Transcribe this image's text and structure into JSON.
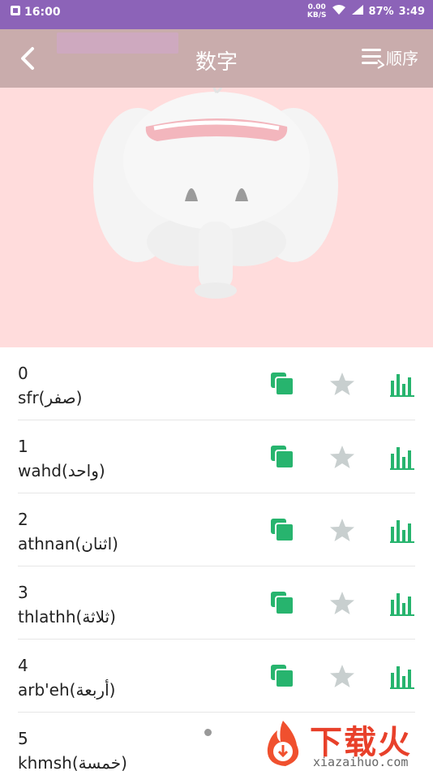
{
  "status_bar": {
    "time": "16:00",
    "net_speed_value": "0.00",
    "net_speed_unit": "KB/S",
    "battery": "87%",
    "clock_right": "3:49"
  },
  "app_bar": {
    "title": "数字",
    "order_label": "顺序"
  },
  "items": [
    {
      "number": "0",
      "word": "sfr(صفر)"
    },
    {
      "number": "1",
      "word": "wahd(واحد)"
    },
    {
      "number": "2",
      "word": "athnan(اثنان)"
    },
    {
      "number": "3",
      "word": "thlathh(ثلاثة)"
    },
    {
      "number": "4",
      "word": "arb'eh(أربعة)"
    },
    {
      "number": "5",
      "word": "khmsh(خمسة)"
    }
  ],
  "watermark": {
    "cn": "下载火",
    "en": "xiazaihuo.com"
  },
  "colors": {
    "status_bar": "#8c63b8",
    "app_bar": "#c9acac",
    "hero_bg": "#ffdcdc",
    "accent_green": "#27b46e",
    "star_gray": "#c8cfcf",
    "watermark_red": "#e8402a"
  },
  "icons": [
    "back-icon",
    "order-menu-icon",
    "copy-icon",
    "star-icon",
    "stats-icon",
    "elephant-illustration"
  ]
}
